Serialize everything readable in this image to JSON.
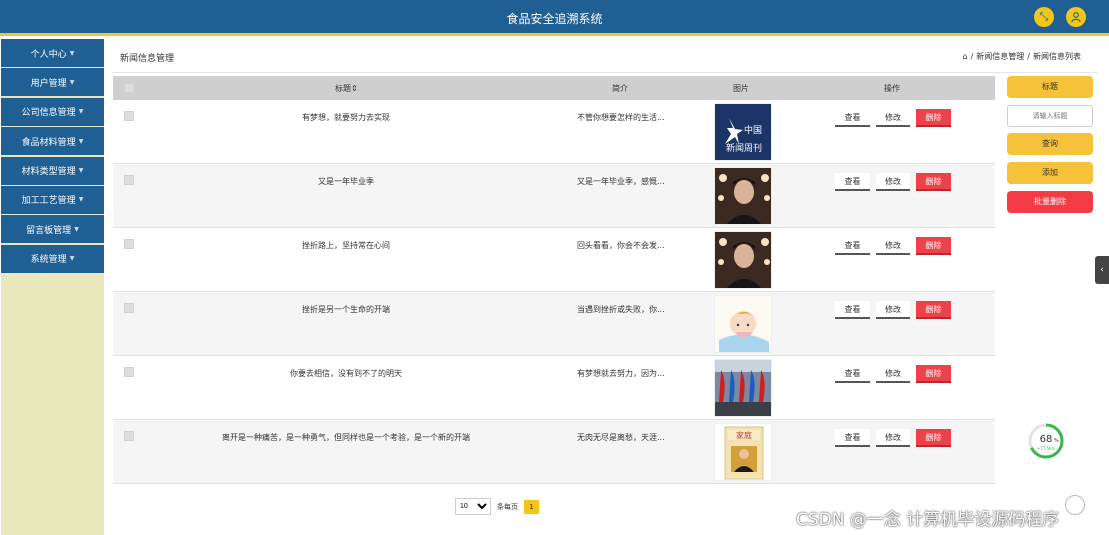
{
  "app": {
    "title": "食品安全追溯系统"
  },
  "sidebar": {
    "items": [
      {
        "label": "个人中心"
      },
      {
        "label": "用户管理"
      },
      {
        "label": "公司信息管理"
      },
      {
        "label": "食品材料管理"
      },
      {
        "label": "材料类型管理"
      },
      {
        "label": "加工工艺管理"
      },
      {
        "label": "留言板管理"
      },
      {
        "label": "系统管理"
      }
    ]
  },
  "page": {
    "title": "新闻信息管理",
    "breadcrumb": [
      "新闻信息管理",
      "新闻信息列表"
    ],
    "breadcrumb_sep": "/"
  },
  "table": {
    "headers": {
      "title": "标题",
      "intro": "简介",
      "image": "图片",
      "actions": "操作"
    },
    "actions": {
      "view": "查看",
      "edit": "修改",
      "delete": "删除"
    },
    "rows": [
      {
        "title": "有梦想，就要努力去实现",
        "intro": "不管你想要怎样的生活...",
        "image_icon": "newsweek-cover"
      },
      {
        "title": "又是一年毕业季",
        "intro": "又是一年毕业季，感慨...",
        "image_icon": "portrait-photo"
      },
      {
        "title": "挫折路上，坚持常在心间",
        "intro": "回头看看，你会不会发...",
        "image_icon": "portrait-photo"
      },
      {
        "title": "挫折是另一个生命的开端",
        "intro": "当遇到挫折或失败，你...",
        "image_icon": "girl-illustration"
      },
      {
        "title": "你要去相信，没有到不了的明天",
        "intro": "有梦想就去努力，因为...",
        "image_icon": "flags-photo"
      },
      {
        "title": "离开是一种痛苦，是一种勇气，但同样也是一个考验，是一个新的开端",
        "intro": "无肉无尽是离愁，天涯...",
        "image_icon": "book-cover"
      }
    ]
  },
  "pager": {
    "page_size": "10",
    "per_page_label": "条每页",
    "current_page": "1"
  },
  "right_panel": {
    "title_button": "标题",
    "search_placeholder": "请输入标题",
    "query_button": "查询",
    "add_button": "添加",
    "batch_delete_button": "批量删除"
  },
  "overlay": {
    "gauge_percent": "68",
    "gauge_sub": "+77.5K/s",
    "gauge_value": 0.68,
    "watermark": "CSDN @一念 计算机毕设源码程序"
  },
  "colors": {
    "header": "#1f5f94",
    "accent": "#f5c518",
    "sidebar_bg": "#e9e8bd",
    "danger": "#f04049"
  }
}
